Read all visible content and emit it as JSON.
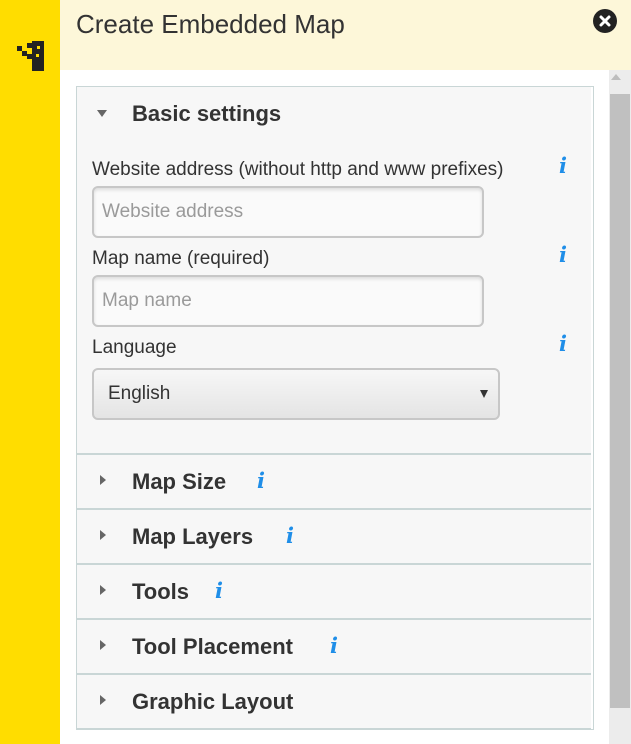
{
  "header": {
    "title": "Create Embedded Map",
    "close_icon": "close-icon"
  },
  "colors": {
    "accent": "#ffdd00",
    "header_bg": "#fdf7d9",
    "info": "#1f8ee8"
  },
  "basic_settings": {
    "title": "Basic settings",
    "expanded": true,
    "website": {
      "label": "Website address (without http and www prefixes)",
      "placeholder": "Website address",
      "value": ""
    },
    "map_name": {
      "label": "Map name (required)",
      "placeholder": "Map name",
      "value": ""
    },
    "language": {
      "label": "Language",
      "selected": "English"
    }
  },
  "sections": [
    {
      "title": "Map Size",
      "has_info": true
    },
    {
      "title": "Map Layers",
      "has_info": true
    },
    {
      "title": "Tools",
      "has_info": true
    },
    {
      "title": "Tool Placement",
      "has_info": true
    },
    {
      "title": "Graphic Layout",
      "has_info": false
    }
  ]
}
